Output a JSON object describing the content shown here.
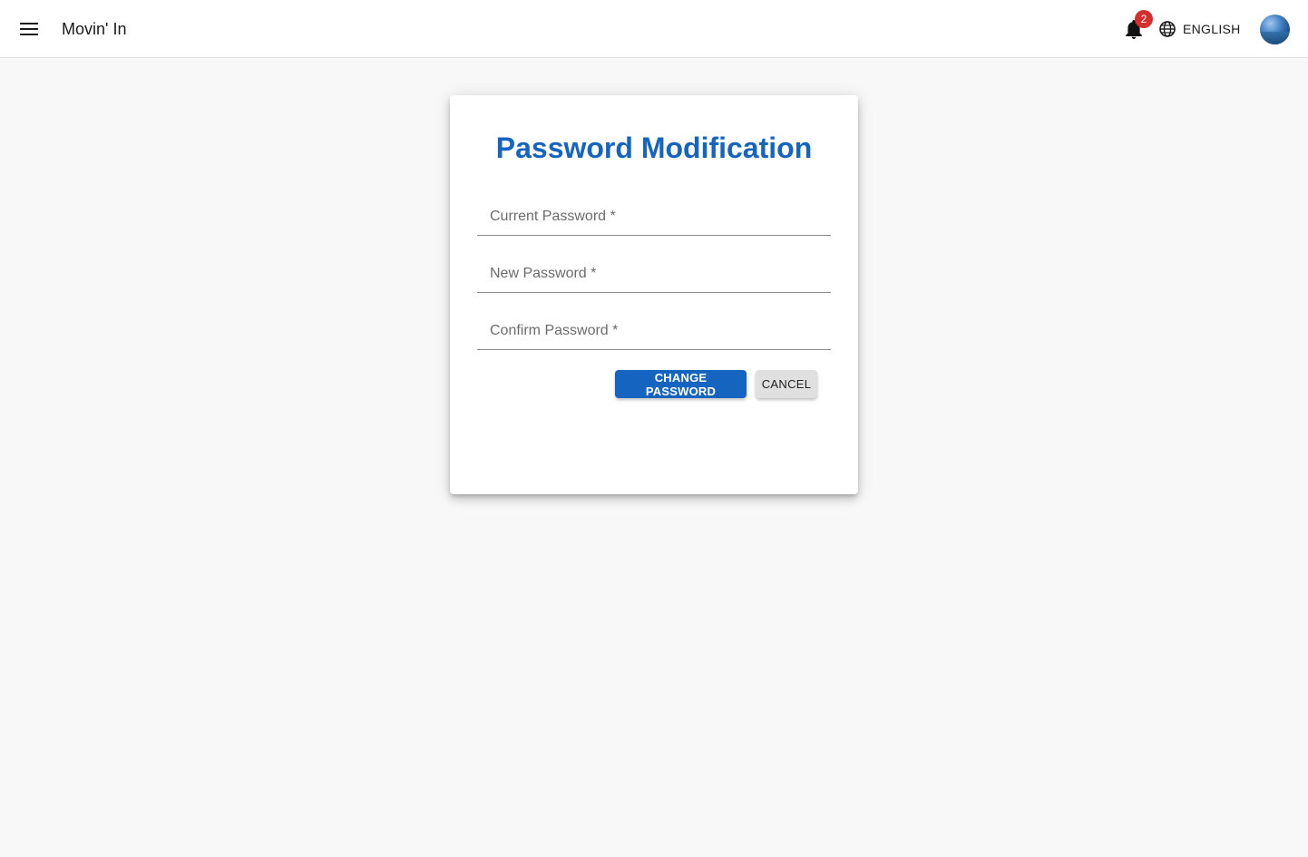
{
  "header": {
    "app_title": "Movin' In",
    "notification_count": "2",
    "language": "ENGLISH"
  },
  "card": {
    "title": "Password Modification",
    "fields": [
      {
        "label": "Current Password *",
        "value": ""
      },
      {
        "label": "New Password *",
        "value": ""
      },
      {
        "label": "Confirm Password *",
        "value": ""
      }
    ],
    "primary_button": "CHANGE PASSWORD",
    "secondary_button": "CANCEL"
  },
  "colors": {
    "accent": "#1565c0",
    "badge": "#d32f2f",
    "background": "#f8f8f8"
  },
  "icons": {
    "menu": "menu-icon",
    "notifications": "bell-icon",
    "language": "globe-icon",
    "avatar": "avatar"
  }
}
